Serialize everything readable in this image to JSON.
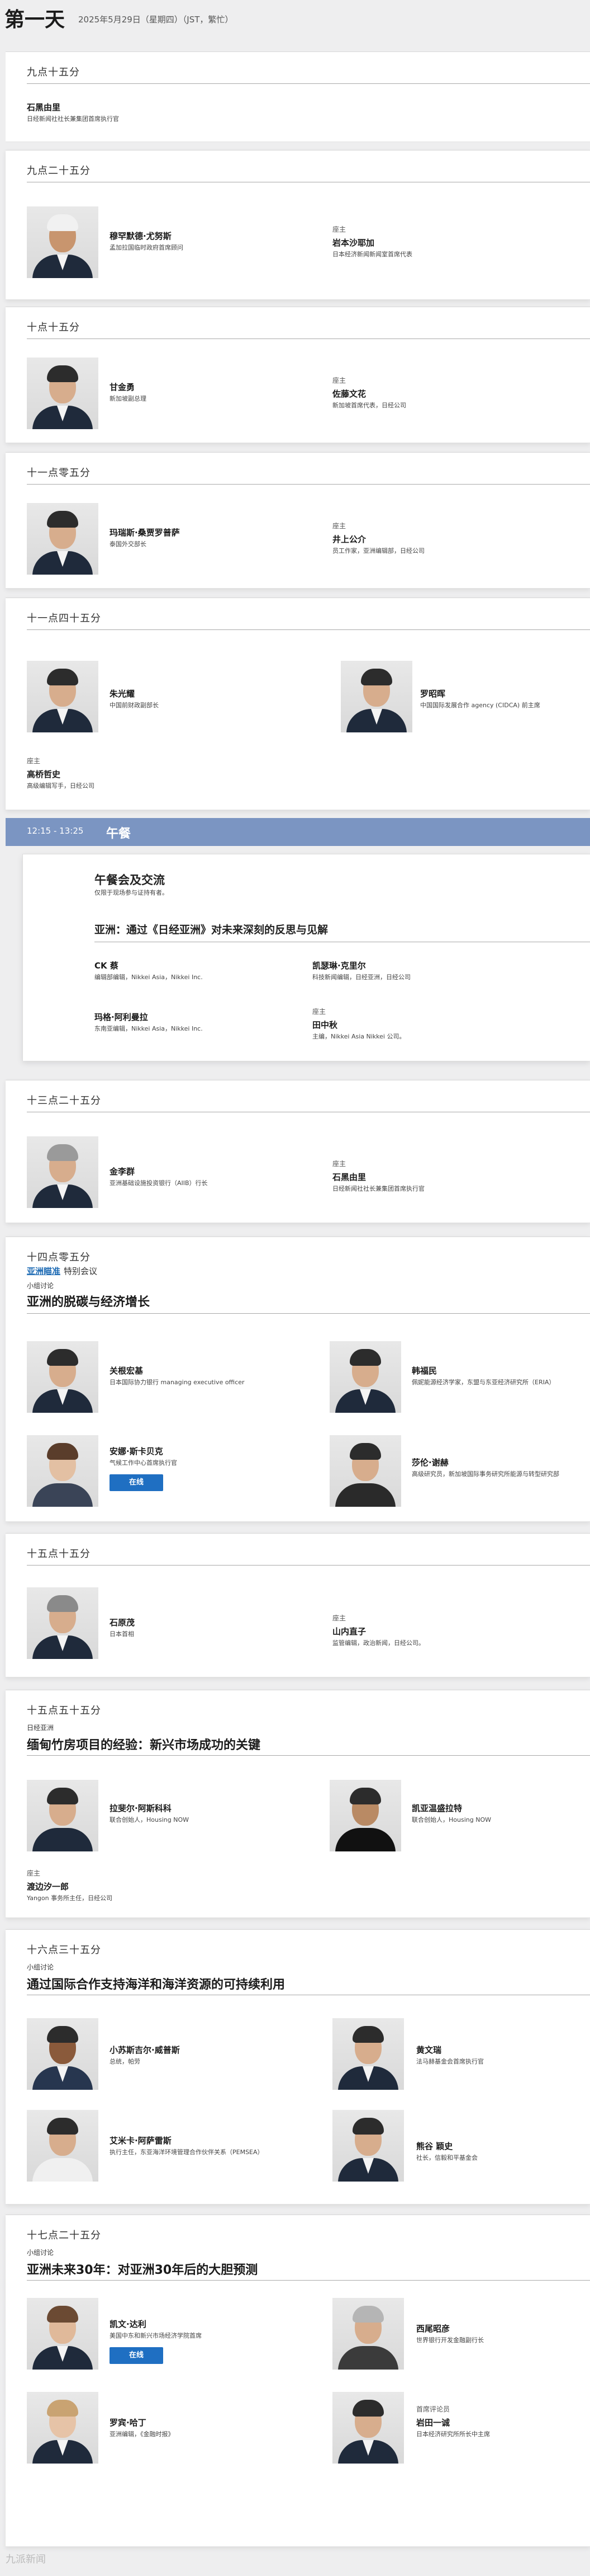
{
  "header": {
    "day": "第一天",
    "date": "2025年5月29日（星期四）（JST，繁忙）"
  },
  "sessions": {
    "s1": {
      "time": "九点十五分",
      "speaker": {
        "name": "石黑由里",
        "title": "日经新闻社社长兼集团首席执行官"
      }
    },
    "s2": {
      "time": "九点二十五分",
      "speaker": {
        "name": "穆罕默德·尤努斯",
        "title": "孟加拉国临时政府首席顾问"
      },
      "host": {
        "role": "座主",
        "name": "岩本沙耶加",
        "title": "日本经济新闻新闻室首席代表"
      }
    },
    "s3": {
      "time": "十点十五分",
      "speaker": {
        "name": "甘金勇",
        "title": "新加坡副总理"
      },
      "host": {
        "role": "座主",
        "name": "佐藤文花",
        "title": "新加坡首席代表，日经公司"
      }
    },
    "s4": {
      "time": "十一点零五分",
      "speaker": {
        "name": "玛瑞斯·桑贾罗普萨",
        "title": "泰国外交部长"
      },
      "host": {
        "role": "座主",
        "name": "井上公介",
        "title": "员工作家，亚洲编辑部，日经公司"
      }
    },
    "s5": {
      "time": "十一点四十五分",
      "speaker1": {
        "name": "朱光耀",
        "title": "中国前财政副部长"
      },
      "speaker2": {
        "name": "罗昭晖",
        "title": "中国国际发展合作 agency (CIDCA) 前主席"
      },
      "host": {
        "role": "座主",
        "name": "高桥哲史",
        "title": "高级编辑写手，日经公司"
      }
    },
    "lunch": {
      "time": "12:15 - 13:25",
      "label": "午餐",
      "title": "午餐会及交流",
      "subtitle": "仅限于现场参与证持有者。",
      "topic": "亚洲：通过《日经亚洲》对未来深刻的反思与见解",
      "p1": {
        "name": "CK 蔡",
        "title": "编辑部编辑，Nikkei Asia，Nikkei Inc."
      },
      "p2": {
        "name": "凯瑟琳·克里尔",
        "title": "科技新闻编辑，日经亚洲，日经公司"
      },
      "p3": {
        "name": "玛格·阿利曼拉",
        "title": "东南亚编辑，Nikkei Asia，Nikkei Inc."
      },
      "p4": {
        "role": "座主",
        "name": "田中秋",
        "title": "主编，Nikkei Asia Nikkei 公司。"
      }
    },
    "s6": {
      "time": "十三点二十五分",
      "speaker": {
        "name": "金李群",
        "title": "亚洲基础设施投资银行（AIIB）行长"
      },
      "host": {
        "role": "座主",
        "name": "石黑由里",
        "title": "日经新闻社社长兼集团首席执行官"
      }
    },
    "s7": {
      "time": "十四点零五分",
      "link": "亚洲瞄准",
      "linkAfter": "特别会议",
      "tag": "小组讨论",
      "title": "亚洲的脱碳与经济增长",
      "p1": {
        "name": "关根宏基",
        "title": "日本国际协力银行 managing executive officer"
      },
      "p2": {
        "name": "韩福民",
        "title": "佩妮能源经济学家，东盟与东亚经济研究所（ERIA）"
      },
      "p3": {
        "name": "安娜·斯卡贝克",
        "title": "气候工作中心首席执行官"
      },
      "p3btn": "在线",
      "p4": {
        "name": "莎伦·谢赫",
        "title": "高级研究员，新加坡国际事务研究所能源与转型研究部"
      }
    },
    "s8": {
      "time": "十五点十五分",
      "speaker": {
        "name": "石原茂",
        "title": "日本首相"
      },
      "host": {
        "role": "座主",
        "name": "山内直子",
        "title": "监管编辑，政治新闻，日经公司。"
      }
    },
    "s9": {
      "time": "十五点五十五分",
      "tag": "日经亚洲",
      "title": "缅甸竹房项目的经验：新兴市场成功的关键",
      "p1": {
        "name": "拉斐尔·阿斯科科",
        "title": "联合创始人，Housing NOW"
      },
      "p2": {
        "name": "凯亚温盛拉特",
        "title": "联合创始人，Housing NOW"
      },
      "host": {
        "role": "座主",
        "name": "渡边汐一郎",
        "title": "Yangon 事务所主任，日经公司"
      }
    },
    "s10": {
      "time": "十六点三十五分",
      "tag": "小组讨论",
      "title": "通过国际合作支持海洋和海洋资源的可持续利用",
      "p1": {
        "name": "小苏斯吉尔·威普斯",
        "title": "总统，帕劳"
      },
      "p2": {
        "name": "黄文瑞",
        "title": "法马赫基金会首席执行官"
      },
      "p3": {
        "name": "艾米卡·阿萨雷斯",
        "title": "执行主任，东亚海洋环境管理合作伙伴关系（PEMSEA）"
      },
      "p4": {
        "name": "熊谷 颖史",
        "title": "社长，信毅和平基金会"
      }
    },
    "s11": {
      "time": "十七点二十五分",
      "tag": "小组讨论",
      "title": "亚洲未来30年：对亚洲30年后的大胆预测",
      "p1": {
        "name": "凯文·达利",
        "title": "美国中东和新兴市场经济学院首席"
      },
      "p1btn": "在线",
      "p2": {
        "name": "西尾昭彦",
        "title": "世界银行开发金融副行长"
      },
      "p3": {
        "name": "罗宾·哈丁",
        "title": "亚洲编辑，《金融时报》"
      },
      "p4": {
        "role": "首席评论员",
        "name": "岩田一诚",
        "title": "日本经济研究所所长中主席"
      }
    }
  },
  "footer": {
    "watermark": "九派新闻"
  },
  "colors": {
    "accent": "#1f6fc2",
    "timeText": "#333333",
    "lunchBar": "#7b95c2",
    "page": "#eeeeef"
  }
}
